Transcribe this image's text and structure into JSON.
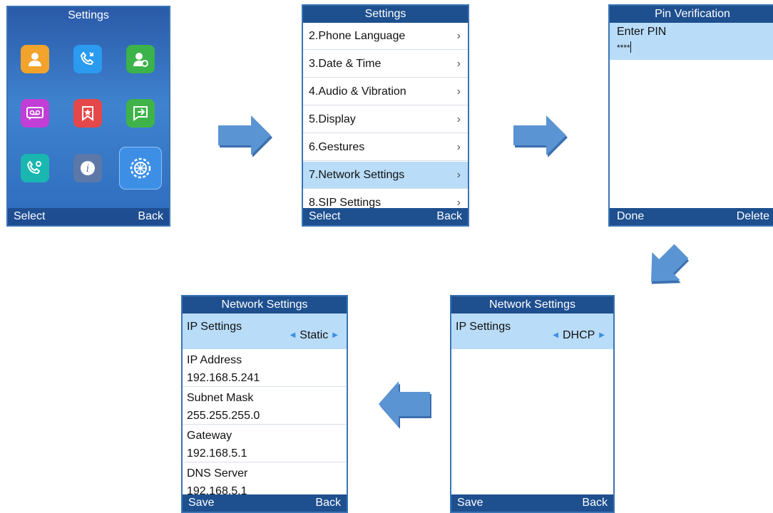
{
  "screen1": {
    "title": "Settings",
    "soft_left": "Select",
    "soft_right": "Back",
    "icons": [
      "contacts-icon",
      "call-history-icon",
      "contact-settings-icon",
      "voicemail-icon",
      "favorites-icon",
      "messages-icon",
      "call-settings-icon",
      "info-icon",
      "settings-gear-icon"
    ]
  },
  "screen2": {
    "title": "Settings",
    "items": [
      "2.Phone Language",
      "3.Date & Time",
      "4.Audio & Vibration",
      "5.Display",
      "6.Gestures",
      "7.Network Settings",
      "8.SIP Settings"
    ],
    "selected_index": 5,
    "soft_left": "Select",
    "soft_right": "Back"
  },
  "screen3": {
    "title": "Pin Verification",
    "prompt": "Enter PIN",
    "pin_value": "****",
    "soft_left": "Done",
    "soft_right": "Delete"
  },
  "screen4": {
    "title": "Network Settings",
    "ip_label": "IP Settings",
    "ip_value": "DHCP",
    "soft_left": "Save",
    "soft_right": "Back"
  },
  "screen5": {
    "title": "Network Settings",
    "ip_label": "IP Settings",
    "ip_value": "Static",
    "fields": [
      {
        "label": "IP Address",
        "value": "192.168.5.241"
      },
      {
        "label": "Subnet Mask",
        "value": "255.255.255.0"
      },
      {
        "label": "Gateway",
        "value": "192.168.5.1"
      },
      {
        "label": "DNS Server",
        "value": "192.168.5.1"
      }
    ],
    "soft_left": "Save",
    "soft_right": "Back"
  },
  "colors": {
    "title_bar": "#1e4f8f",
    "selection": "#b9dcf8",
    "arrow": "#5a94d2",
    "border": "#3a74b5"
  }
}
